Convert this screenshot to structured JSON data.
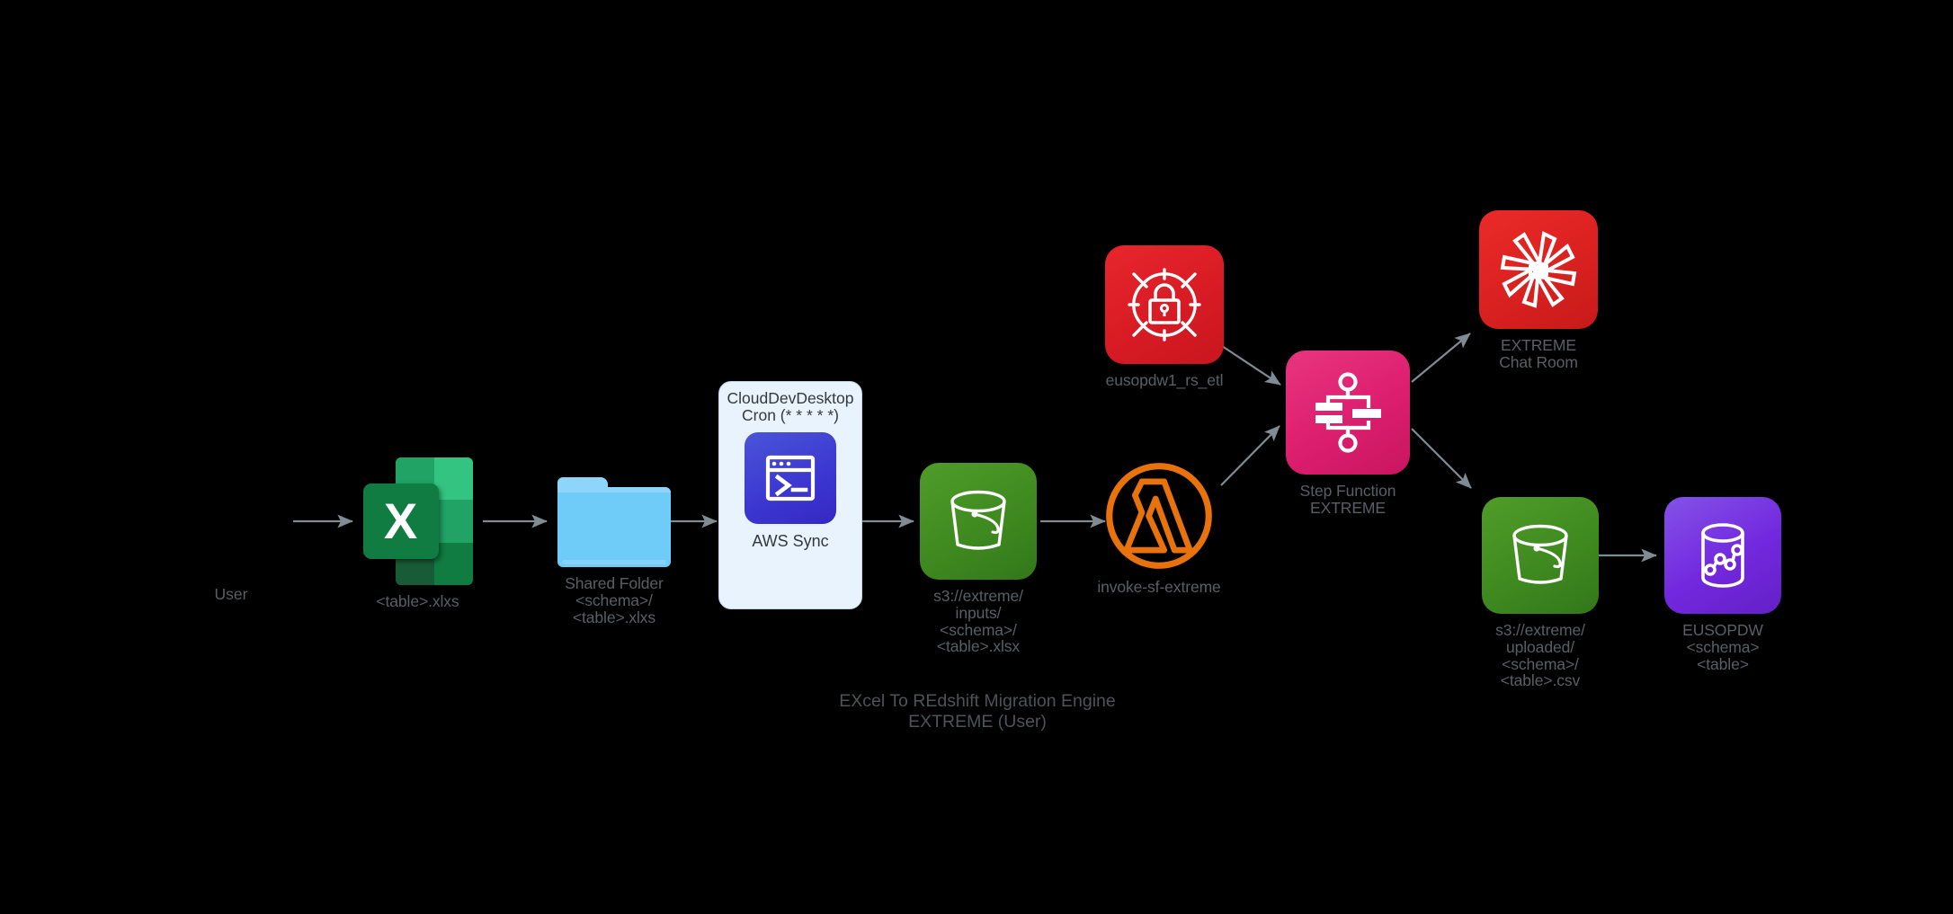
{
  "diagram": {
    "caption": "EXcel To REdshift Migration Engine\nEXTREME (User)",
    "background_color": "#000000",
    "edge_color": "#7f8c93",
    "label_color": "#595f63"
  },
  "nodes": {
    "user": {
      "label": "User",
      "icon": "user-node"
    },
    "excel": {
      "label": "<table>.xlxs",
      "icon": "excel-icon",
      "color": "#107c41"
    },
    "shared_folder": {
      "label": "Shared Folder\n<schema>/\n<table>.xlxs",
      "icon": "folder-icon",
      "color": "#6fcbf7"
    },
    "clouddevdesktop": {
      "title": "CloudDevDesktop\nCron (* * * * *)",
      "sub_label": "AWS Sync",
      "icon": "terminal-icon",
      "color": "#3b36d0",
      "box_color": "#e8f3fd"
    },
    "s3_inputs": {
      "label": "s3://extreme/\ninputs/\n<schema>/\n<table>.xlsx",
      "icon": "s3-bucket-icon",
      "color": "#3f8a20"
    },
    "lambda": {
      "label": "invoke-sf-extreme",
      "icon": "lambda-icon",
      "color": "#e8720c"
    },
    "secrets": {
      "label": "eusopdw1_rs_etl",
      "icon": "secrets-manager-lock-icon",
      "color": "#d81b24"
    },
    "stepfunction": {
      "label": "Step Function\nEXTREME",
      "icon": "step-functions-icon",
      "color": "#dc1e6e"
    },
    "chatroom": {
      "label": "EXTREME\nChat Room",
      "icon": "chat-room-icon",
      "color": "#da2120"
    },
    "s3_uploaded": {
      "label": "s3://extreme/\nuploaded/\n<schema>/\n<table>.csv",
      "icon": "s3-bucket-icon",
      "color": "#3f8a20"
    },
    "redshift": {
      "label": "EUSOPDW\n<schema>\n<table>",
      "icon": "redshift-icon",
      "color": "#7228de"
    }
  }
}
